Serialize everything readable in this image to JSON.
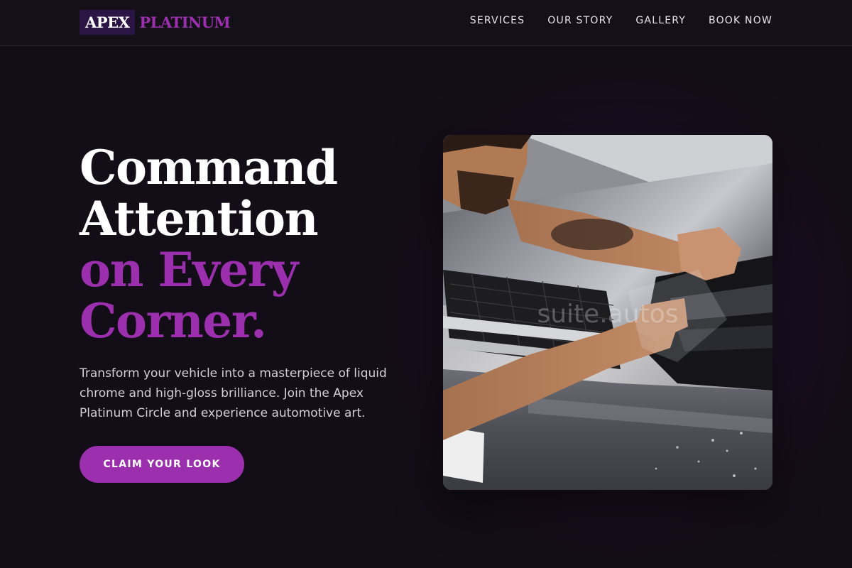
{
  "brand": {
    "name_part1": "APEX",
    "name_part2": "PLATINUM",
    "accent_color": "#9b2fae"
  },
  "nav": {
    "items": [
      {
        "label": "SERVICES"
      },
      {
        "label": "OUR STORY"
      },
      {
        "label": "GALLERY"
      },
      {
        "label": "BOOK NOW"
      }
    ]
  },
  "hero": {
    "title_lines": [
      "Command",
      "Attention",
      "on Every",
      "Corner."
    ],
    "subtitle": "Transform your vehicle into a masterpiece of liquid chrome and high-gloss brilliance. Join the Apex Platinum Circle and experience automotive art.",
    "cta_label": "CLAIM YOUR LOOK",
    "image_watermark": "suite.autos"
  }
}
